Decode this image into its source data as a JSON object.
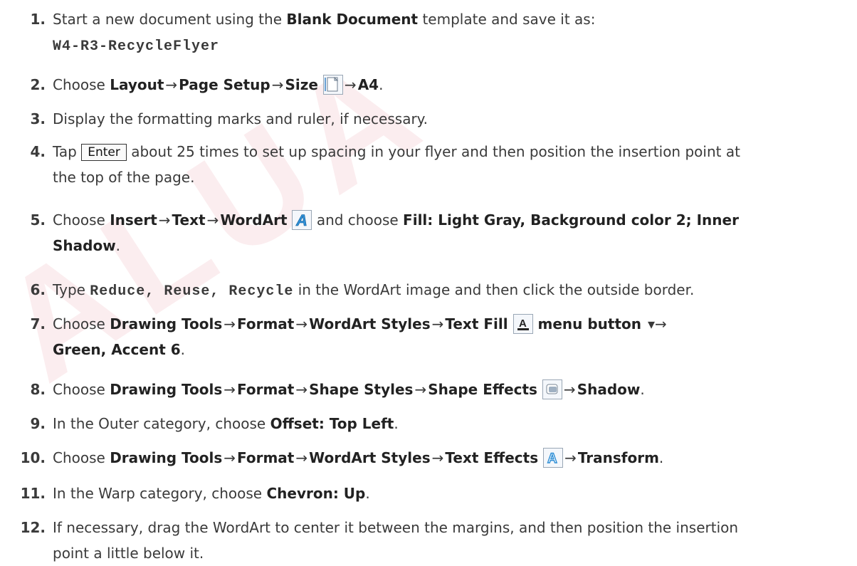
{
  "watermark": "ALUA",
  "steps": [
    {
      "num": "1.",
      "parts": [
        "Start a new document using the ",
        {
          "b": "Blank Document"
        },
        " template and save it as:"
      ],
      "line2": [
        {
          "mono": "W4-R3-RecycleFlyer"
        }
      ]
    },
    {
      "num": "2.",
      "parts": [
        "Choose ",
        {
          "b": "Layout"
        },
        {
          "arr": "→"
        },
        {
          "b": "Page Setup"
        },
        {
          "arr": "→"
        },
        {
          "b": "Size "
        },
        {
          "icon": "page-size-icon"
        },
        {
          "arr": "→"
        },
        {
          "b": "A4"
        },
        "."
      ]
    },
    {
      "num": "3.",
      "parts": [
        "Display the formatting marks and ruler, if necessary."
      ]
    },
    {
      "num": "4.",
      "parts": [
        "Tap ",
        {
          "key": "Enter"
        },
        " about 25 times to set up spacing in your flyer and then position the insertion point at"
      ],
      "line2": [
        "the top of the page."
      ]
    },
    {
      "num": "5.",
      "parts": [
        "Choose ",
        {
          "b": "Insert"
        },
        {
          "arr": "→"
        },
        {
          "b": "Text"
        },
        {
          "arr": "→"
        },
        {
          "b": "WordArt "
        },
        {
          "icon": "wordart-icon"
        },
        " and choose ",
        {
          "b": "Fill: Light Gray, Background color 2; Inner"
        }
      ],
      "line2": [
        {
          "b": "Shadow"
        },
        "."
      ]
    },
    {
      "num": "6.",
      "parts": [
        "Type ",
        {
          "mono": "Reduce, Reuse, Recycle"
        },
        " in the WordArt image and then click the outside border."
      ]
    },
    {
      "num": "7.",
      "parts": [
        "Choose ",
        {
          "b": "Drawing Tools"
        },
        {
          "arr": "→"
        },
        {
          "b": "Format"
        },
        {
          "arr": "→"
        },
        {
          "b": "WordArt Styles"
        },
        {
          "arr": "→"
        },
        {
          "b": "Text Fill "
        },
        {
          "icon": "text-fill-icon"
        },
        {
          "b": " menu button "
        },
        {
          "arr": "▾→"
        }
      ],
      "line2": [
        {
          "b": "Green, Accent 6"
        },
        "."
      ]
    },
    {
      "num": "8.",
      "parts": [
        "Choose ",
        {
          "b": "Drawing Tools"
        },
        {
          "arr": "→"
        },
        {
          "b": "Format"
        },
        {
          "arr": "→"
        },
        {
          "b": "Shape Styles"
        },
        {
          "arr": "→"
        },
        {
          "b": "Shape Effects "
        },
        {
          "icon": "shape-effects-icon"
        },
        {
          "arr": "→"
        },
        {
          "b": "Shadow"
        },
        "."
      ]
    },
    {
      "num": "9.",
      "parts": [
        "In the Outer category, choose ",
        {
          "b": "Offset: Top Left"
        },
        "."
      ]
    },
    {
      "num": "10.",
      "parts": [
        "Choose ",
        {
          "b": "Drawing Tools"
        },
        {
          "arr": "→"
        },
        {
          "b": "Format"
        },
        {
          "arr": "→"
        },
        {
          "b": "WordArt Styles"
        },
        {
          "arr": "→"
        },
        {
          "b": "Text Effects "
        },
        {
          "icon": "text-effects-icon"
        },
        {
          "arr": "→"
        },
        {
          "b": "Transform"
        },
        "."
      ]
    },
    {
      "num": "11.",
      "parts": [
        "In the Warp category, choose ",
        {
          "b": "Chevron: Up"
        },
        "."
      ]
    },
    {
      "num": "12.",
      "parts": [
        "If necessary, drag the WordArt to center it between the margins, and then position the insertion"
      ],
      "line2": [
        "point a little below it."
      ]
    }
  ]
}
